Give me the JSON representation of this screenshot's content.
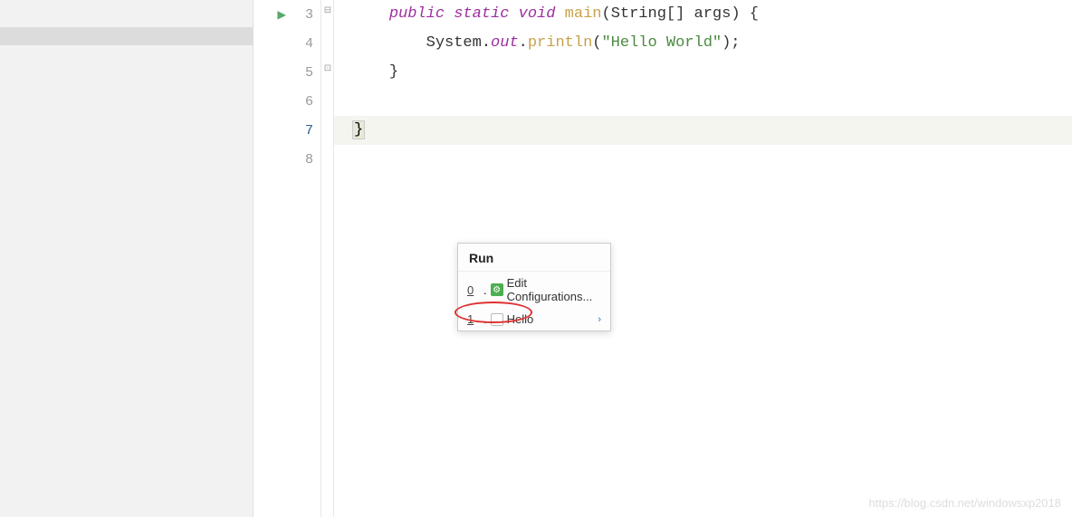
{
  "gutter": {
    "lines": [
      "3",
      "4",
      "5",
      "6",
      "7",
      "8"
    ],
    "current_line": "7"
  },
  "code": {
    "line3": {
      "indent": "    ",
      "mod_public": "public",
      "mod_static": "static",
      "kw_void": "void",
      "fn_main": "main",
      "lparen": "(",
      "type_string": "String",
      "brackets": "[]",
      "param_args": " args",
      "rparen_brace": ") {"
    },
    "line4": {
      "indent": "        ",
      "system": "System",
      "dot1": ".",
      "out": "out",
      "dot2": ".",
      "println": "println",
      "lparen": "(",
      "string_val": "\"Hello World\"",
      "rparen_semi": ");"
    },
    "line5": {
      "indent": "    ",
      "brace": "}"
    },
    "line7": {
      "brace": "}"
    }
  },
  "popup": {
    "title": "Run",
    "items": [
      {
        "num": "0",
        "label": "Edit Configurations..."
      },
      {
        "num": "1",
        "label": "Hello"
      }
    ]
  },
  "watermark": "https://blog.csdn.net/windowsxp2018"
}
